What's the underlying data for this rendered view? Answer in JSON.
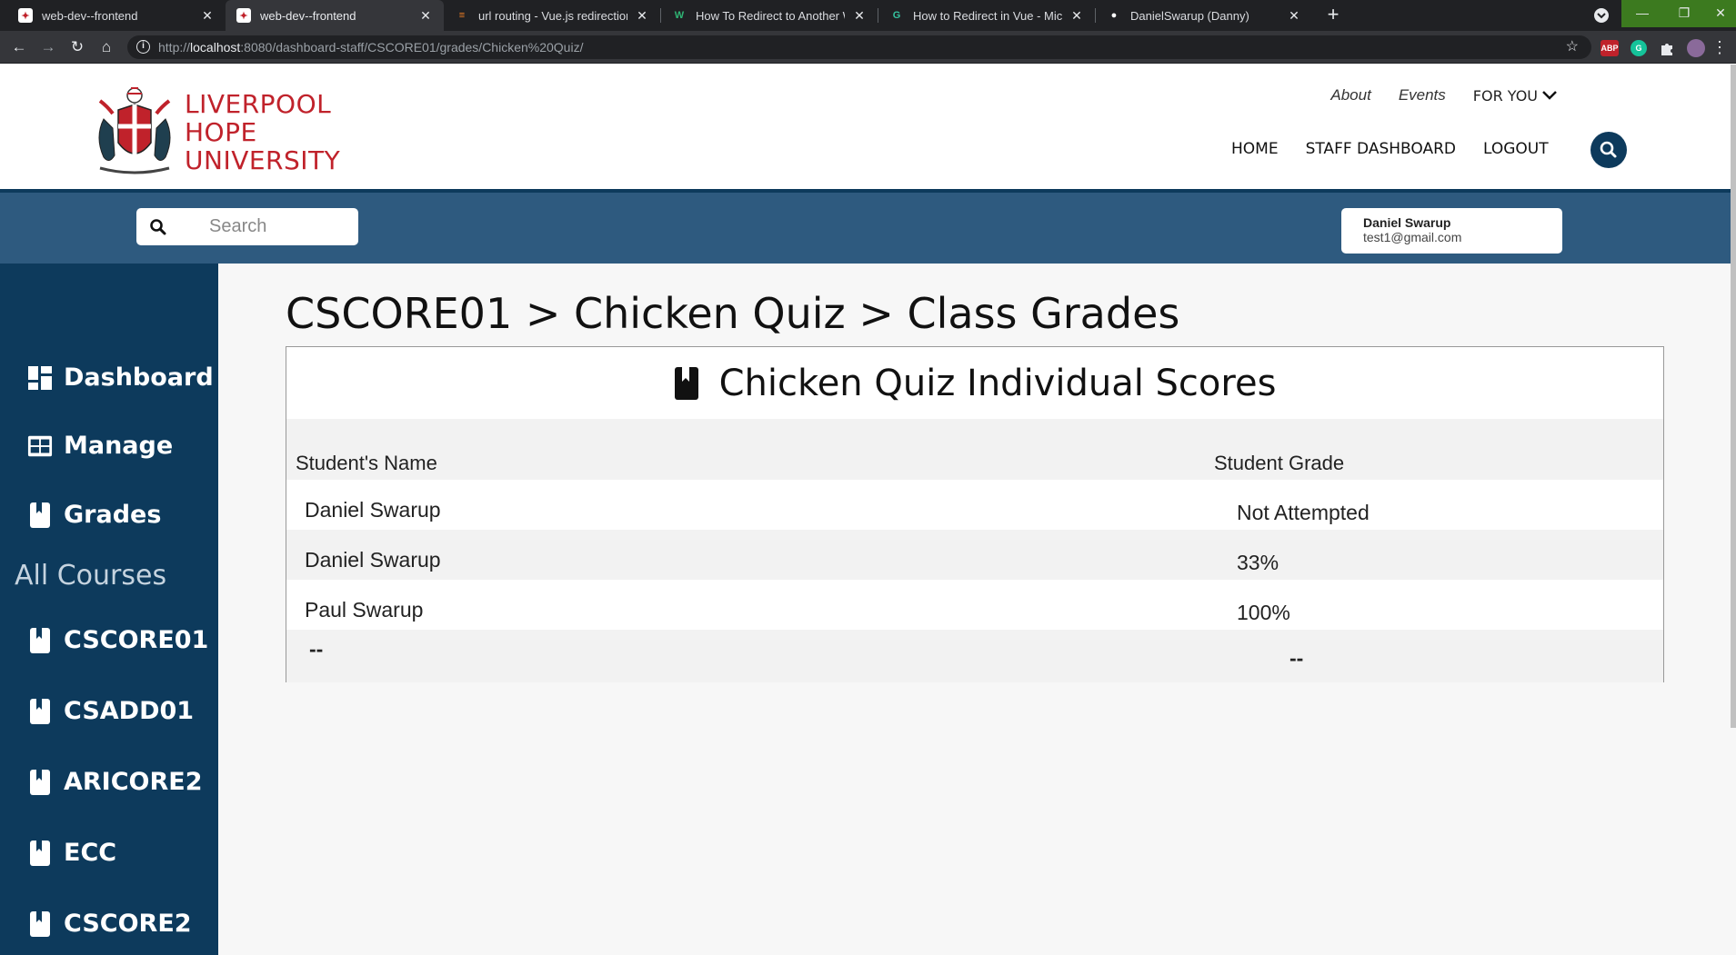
{
  "browser": {
    "tabs": [
      {
        "title": "web-dev--frontend",
        "active": false
      },
      {
        "title": "web-dev--frontend",
        "active": true
      },
      {
        "title": "url routing - Vue.js redirection to",
        "active": false
      },
      {
        "title": "How To Redirect to Another Web",
        "active": false
      },
      {
        "title": "How to Redirect in Vue - Michael",
        "active": false
      },
      {
        "title": "DanielSwarup (Danny)",
        "active": false
      }
    ],
    "url_prefix": "http://",
    "url_host": "localhost",
    "url_rest": ":8080/dashboard-staff/CSCORE01/grades/Chicken%20Quiz/",
    "ext_abp": "ABP",
    "ext_g": "G"
  },
  "header": {
    "brand_line1": "LIVERPOOL",
    "brand_line2": "HOPE",
    "brand_line3": "UNIVERSITY",
    "top_links": {
      "about": "About",
      "events": "Events",
      "for_you": "FOR YOU"
    },
    "nav": {
      "home": "HOME",
      "staff_dashboard": "STAFF DASHBOARD",
      "logout": "LOGOUT"
    }
  },
  "toolbar": {
    "search_placeholder": "Search",
    "user_name": "Daniel Swarup",
    "user_email": "test1@gmail.com"
  },
  "sidebar": {
    "dashboard": "Dashboard",
    "manage": "Manage",
    "grades": "Grades",
    "all_courses": "All Courses",
    "courses": [
      "CSCORE01",
      "CSADD01",
      "ARICORE2",
      "ECC",
      "CSCORE2"
    ]
  },
  "main": {
    "page_title": "CSCORE01 > Chicken Quiz > Class Grades",
    "card_title": "Chicken Quiz Individual Scores",
    "col_name": "Student's Name",
    "col_grade": "Student Grade",
    "rows": [
      {
        "name": "Daniel Swarup",
        "grade": "Not Attempted"
      },
      {
        "name": "Daniel Swarup",
        "grade": "33%"
      },
      {
        "name": "Paul Swarup",
        "grade": "100%"
      },
      {
        "name": "--",
        "grade": "--"
      }
    ]
  },
  "colors": {
    "navy": "#0d3a5c",
    "bar_blue": "#2e5a7f",
    "brand_red": "#c0222b"
  }
}
